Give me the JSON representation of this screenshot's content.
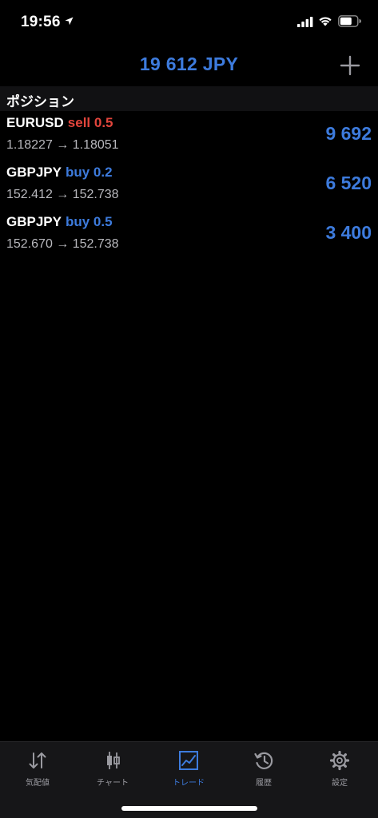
{
  "status_bar": {
    "time": "19:56",
    "icons": [
      "location-arrow-icon",
      "cellular-signal-icon",
      "wifi-icon",
      "battery-icon"
    ]
  },
  "header": {
    "balance": "19 612 JPY",
    "add_icon": "plus-icon"
  },
  "section": {
    "title": "ポジション"
  },
  "positions": [
    {
      "symbol": "EURUSD",
      "side": "sell 0.5",
      "prices": "1.18227 → 1.18051",
      "profit": "9 692"
    },
    {
      "symbol": "GBPJPY",
      "side": "buy 0.2",
      "prices": "152.412 → 152.738",
      "profit": "6 520"
    },
    {
      "symbol": "GBPJPY",
      "side": "buy 0.5",
      "prices": "152.670 → 152.738",
      "profit": "3 400"
    }
  ],
  "tabs": [
    {
      "label": "気配値",
      "icon": "quotes-arrows-icon"
    },
    {
      "label": "チャート",
      "icon": "candlestick-chart-icon"
    },
    {
      "label": "トレード",
      "icon": "trade-chart-icon",
      "active": true
    },
    {
      "label": "履歴",
      "icon": "history-clock-icon"
    },
    {
      "label": "設定",
      "icon": "settings-gear-icon"
    }
  ],
  "colors": {
    "accent": "#3d7bdd",
    "sell": "#e2453c",
    "background": "#000000",
    "tab_bar": "#161618"
  }
}
